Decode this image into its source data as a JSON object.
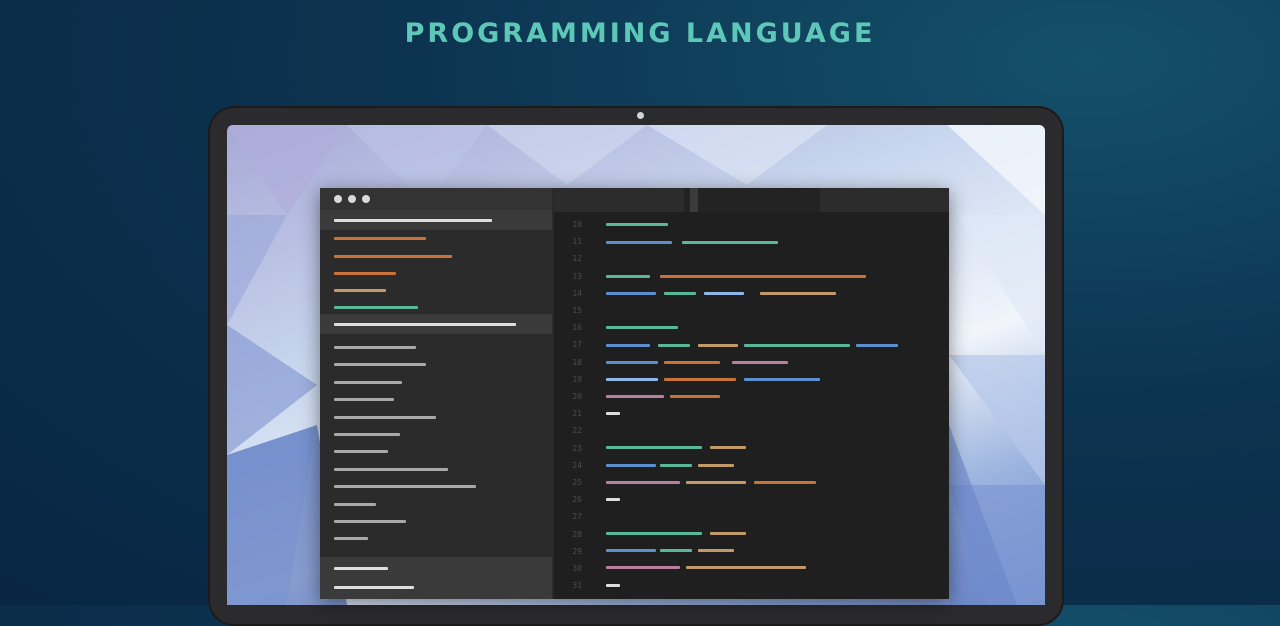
{
  "header": {
    "title": "PROGRAMMING LANGUAGE"
  },
  "colors": {
    "title": "#5ec8b8",
    "green": "#5ab89a",
    "blue": "#5b8fd0",
    "orange": "#c9733a",
    "tan": "#c29a68",
    "pink": "#b8809a",
    "gray": "#a8a8a8",
    "white": "#dedede"
  },
  "editor": {
    "line_numbers": [
      "10",
      "11",
      "12",
      "13",
      "14",
      "15",
      "16",
      "17",
      "18",
      "19",
      "20",
      "21",
      "22",
      "23",
      "24",
      "25",
      "26",
      "27",
      "28",
      "29",
      "30",
      "31"
    ]
  }
}
